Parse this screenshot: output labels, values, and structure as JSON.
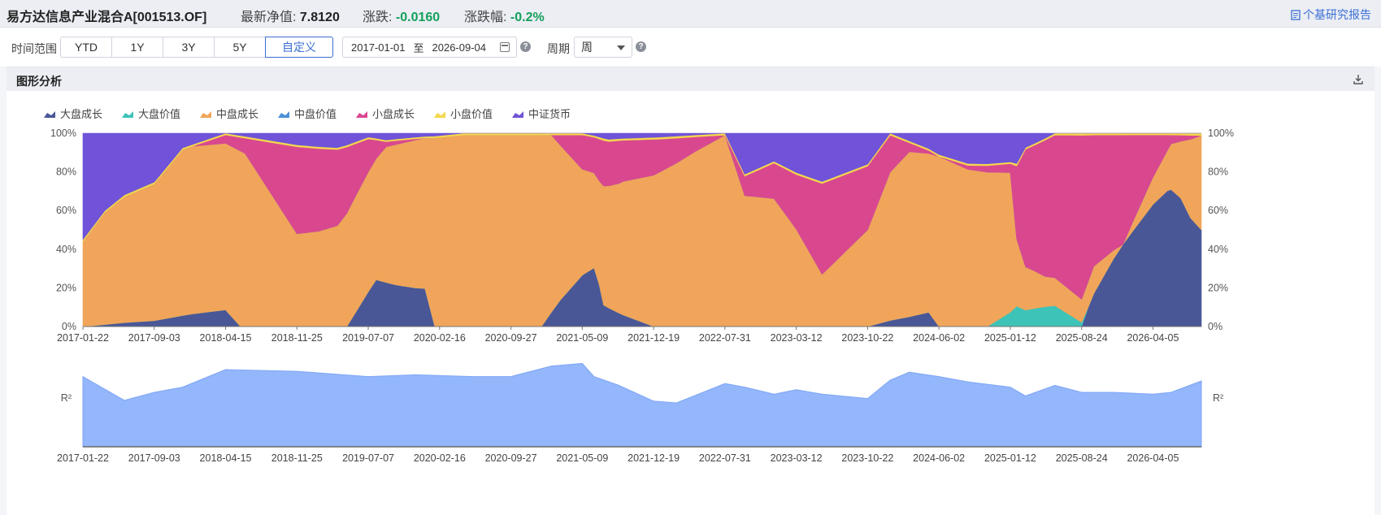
{
  "header": {
    "fund_name": "易方达信息产业混合A[001513.OF]",
    "nav_label": "最新净值:",
    "nav_value": "7.8120",
    "change_label": "涨跌:",
    "change_value": "-0.0160",
    "pct_label": "涨跌幅:",
    "pct_value": "-0.2%",
    "report_link": "个基研究报告"
  },
  "toolbar": {
    "range_label": "时间范围",
    "range_buttons": [
      "YTD",
      "1Y",
      "3Y",
      "5Y",
      "自定义"
    ],
    "active_range": "自定义",
    "start_date": "2017-01-01",
    "date_sep": "至",
    "end_date": "2026-09-04",
    "period_label": "周期",
    "period_value": "周"
  },
  "panel": {
    "title": "图形分析"
  },
  "colors": {
    "大盘成长": "#4a5797",
    "大盘价值": "#3ec3b8",
    "中盘成长": "#f0a55a",
    "中盘价值": "#4a8fd6",
    "小盘成长": "#d9488f",
    "小盘价值": "#f3d84c",
    "中证货币": "#7053d8",
    "r2_fill": "#94b6fb"
  },
  "chart_data": [
    {
      "type": "area",
      "stacked": true,
      "normalized": true,
      "legend_position": "top-left",
      "legend": [
        "大盘成长",
        "大盘价值",
        "中盘成长",
        "中盘价值",
        "小盘成长",
        "小盘价值",
        "中证货币"
      ],
      "x_ticks": [
        "2017-01-22",
        "2017-09-03",
        "2018-04-15",
        "2018-11-25",
        "2019-07-07",
        "2020-02-16",
        "2020-09-27",
        "2021-05-09",
        "2021-12-19",
        "2022-07-31",
        "2023-03-12",
        "2023-10-22",
        "2024-06-02",
        "2025-01-12",
        "2025-08-24",
        "2026-04-05"
      ],
      "y_ticks": [
        "0%",
        "20%",
        "40%",
        "60%",
        "80%",
        "100%"
      ],
      "ylim": [
        0,
        100
      ],
      "x_range": [
        "2017-01-22",
        "2026-09-04"
      ],
      "series": [
        {
          "name": "大盘成长",
          "points": [
            [
              "2017-01-22",
              0
            ],
            [
              "2017-06-01",
              2
            ],
            [
              "2017-09-03",
              3
            ],
            [
              "2018-01-01",
              7
            ],
            [
              "2018-04-15",
              10
            ],
            [
              "2018-06-01",
              0
            ],
            [
              "2019-05-01",
              0
            ],
            [
              "2019-07-07",
              18
            ],
            [
              "2019-08-01",
              27
            ],
            [
              "2019-10-01",
              25
            ],
            [
              "2020-01-01",
              24
            ],
            [
              "2020-02-01",
              0
            ],
            [
              "2021-01-01",
              0
            ],
            [
              "2021-03-01",
              15
            ],
            [
              "2021-05-09",
              30
            ],
            [
              "2021-06-15",
              34
            ],
            [
              "2021-07-15",
              10
            ],
            [
              "2021-12-19",
              0
            ],
            [
              "2023-10-22",
              0
            ],
            [
              "2024-05-01",
              8
            ],
            [
              "2024-06-02",
              0
            ],
            [
              "2025-08-24",
              0
            ],
            [
              "2025-10-01",
              18
            ],
            [
              "2025-12-01",
              38
            ],
            [
              "2026-02-01",
              55
            ],
            [
              "2026-04-05",
              72
            ],
            [
              "2026-05-20",
              80
            ],
            [
              "2026-07-01",
              70
            ],
            [
              "2026-08-01",
              50
            ],
            [
              "2026-09-04",
              43
            ]
          ]
        },
        {
          "name": "大盘价值",
          "points": [
            [
              "2017-01-22",
              0
            ],
            [
              "2024-11-01",
              0
            ],
            [
              "2025-01-12",
              8
            ],
            [
              "2025-04-01",
              10
            ],
            [
              "2025-06-01",
              11
            ],
            [
              "2025-08-24",
              2
            ],
            [
              "2025-09-15",
              0
            ],
            [
              "2026-09-04",
              0
            ]
          ]
        },
        {
          "name": "中盘成长",
          "points": [
            [
              "2017-01-22",
              44
            ],
            [
              "2017-04-01",
              62
            ],
            [
              "2017-09-03",
              70
            ],
            [
              "2017-12-01",
              90
            ],
            [
              "2018-04-15",
              100
            ],
            [
              "2018-06-15",
              92
            ],
            [
              "2018-09-01",
              70
            ],
            [
              "2018-11-25",
              48
            ],
            [
              "2019-02-01",
              50
            ],
            [
              "2019-05-15",
              60
            ],
            [
              "2019-07-07",
              62
            ],
            [
              "2019-09-01",
              80
            ],
            [
              "2019-12-01",
              93
            ],
            [
              "2020-02-16",
              98
            ],
            [
              "2020-09-27",
              100
            ],
            [
              "2021-02-01",
              98
            ],
            [
              "2021-05-09",
              62
            ],
            [
              "2021-07-01",
              52
            ],
            [
              "2021-09-15",
              70
            ],
            [
              "2021-12-19",
              76
            ],
            [
              "2022-03-01",
              80
            ],
            [
              "2022-05-01",
              90
            ],
            [
              "2022-07-31",
              98
            ],
            [
              "2022-10-01",
              67
            ],
            [
              "2023-01-01",
              73
            ],
            [
              "2023-03-12",
              50
            ],
            [
              "2023-06-01",
              27
            ],
            [
              "2023-10-22",
              50
            ],
            [
              "2024-01-01",
              72
            ],
            [
              "2024-03-01",
              92
            ],
            [
              "2024-06-02",
              88
            ],
            [
              "2024-09-01",
              83
            ],
            [
              "2025-01-12",
              78
            ],
            [
              "2025-02-01",
              28
            ],
            [
              "2025-05-01",
              16
            ],
            [
              "2025-08-24",
              11
            ],
            [
              "2025-10-01",
              15
            ],
            [
              "2026-01-01",
              0
            ],
            [
              "2026-09-04",
              42
            ]
          ]
        },
        {
          "name": "中盘价值",
          "points": [
            [
              "2017-01-22",
              0
            ],
            [
              "2026-09-04",
              0
            ]
          ]
        },
        {
          "name": "小盘成长",
          "points": [
            [
              "2017-01-22",
              0
            ],
            [
              "2018-01-01",
              0
            ],
            [
              "2018-06-15",
              8
            ],
            [
              "2018-11-25",
              45
            ],
            [
              "2019-04-01",
              42
            ],
            [
              "2019-07-07",
              17
            ],
            [
              "2019-09-01",
              3
            ],
            [
              "2020-01-01",
              0
            ],
            [
              "2021-02-01",
              0
            ],
            [
              "2021-05-09",
              20
            ],
            [
              "2021-09-01",
              22
            ],
            [
              "2021-12-19",
              18
            ],
            [
              "2022-07-31",
              0
            ],
            [
              "2022-10-01",
              10
            ],
            [
              "2023-03-12",
              28
            ],
            [
              "2023-06-01",
              47
            ],
            [
              "2023-10-22",
              33
            ],
            [
              "2024-03-01",
              5
            ],
            [
              "2024-06-02",
              0
            ],
            [
              "2025-01-12",
              5
            ],
            [
              "2025-03-01",
              66
            ],
            [
              "2025-06-01",
              75
            ],
            [
              "2025-08-24",
              78
            ],
            [
              "2025-10-01",
              72
            ],
            [
              "2026-01-01",
              62
            ],
            [
              "2026-04-05",
              25
            ],
            [
              "2026-06-01",
              5
            ],
            [
              "2026-09-04",
              0
            ]
          ]
        },
        {
          "name": "小盘价值",
          "points": [
            [
              "2017-01-22",
              1
            ],
            [
              "2026-09-04",
              1
            ]
          ]
        },
        {
          "name": "中证货币",
          "points": [
            [
              "2017-01-22",
              55
            ],
            [
              "2017-06-01",
              32
            ],
            [
              "2017-09-03",
              25
            ],
            [
              "2017-12-01",
              8
            ],
            [
              "2018-04-15",
              0
            ],
            [
              "2018-11-25",
              6
            ],
            [
              "2019-04-01",
              8
            ],
            [
              "2019-07-07",
              2
            ],
            [
              "2019-09-01",
              4
            ],
            [
              "2020-01-01",
              2
            ],
            [
              "2020-05-01",
              0
            ],
            [
              "2021-05-09",
              0
            ],
            [
              "2021-08-01",
              3
            ],
            [
              "2022-01-01",
              2
            ],
            [
              "2022-07-31",
              0
            ],
            [
              "2022-10-01",
              21
            ],
            [
              "2023-01-01",
              16
            ],
            [
              "2023-06-01",
              25
            ],
            [
              "2023-10-22",
              16
            ],
            [
              "2024-01-01",
              0
            ],
            [
              "2024-06-02",
              11
            ],
            [
              "2024-09-01",
              16
            ],
            [
              "2025-01-12",
              16
            ],
            [
              "2025-03-01",
              8
            ],
            [
              "2025-06-01",
              0
            ],
            [
              "2026-09-04",
              0
            ]
          ]
        }
      ]
    },
    {
      "type": "area",
      "ylabel": "R²",
      "x_ticks": [
        "2017-01-22",
        "2017-09-03",
        "2018-04-15",
        "2018-11-25",
        "2019-07-07",
        "2020-02-16",
        "2020-09-27",
        "2021-05-09",
        "2021-12-19",
        "2022-07-31",
        "2023-03-12",
        "2023-10-22",
        "2024-06-02",
        "2025-01-12",
        "2025-08-24",
        "2026-04-05"
      ],
      "ylim": [
        0,
        1
      ],
      "series": [
        {
          "name": "R²",
          "points": [
            [
              "2017-01-22",
              0.8
            ],
            [
              "2017-06-01",
              0.53
            ],
            [
              "2017-09-03",
              0.62
            ],
            [
              "2017-12-01",
              0.68
            ],
            [
              "2018-04-15",
              0.88
            ],
            [
              "2018-11-25",
              0.86
            ],
            [
              "2019-07-07",
              0.8
            ],
            [
              "2019-12-01",
              0.82
            ],
            [
              "2020-06-01",
              0.8
            ],
            [
              "2020-09-27",
              0.8
            ],
            [
              "2021-02-01",
              0.92
            ],
            [
              "2021-05-09",
              0.95
            ],
            [
              "2021-06-15",
              0.8
            ],
            [
              "2021-09-01",
              0.7
            ],
            [
              "2021-12-19",
              0.52
            ],
            [
              "2022-03-01",
              0.5
            ],
            [
              "2022-07-31",
              0.72
            ],
            [
              "2022-10-01",
              0.68
            ],
            [
              "2023-01-01",
              0.6
            ],
            [
              "2023-03-12",
              0.65
            ],
            [
              "2023-06-01",
              0.6
            ],
            [
              "2023-10-22",
              0.55
            ],
            [
              "2024-01-01",
              0.76
            ],
            [
              "2024-03-01",
              0.85
            ],
            [
              "2024-06-02",
              0.8
            ],
            [
              "2024-09-01",
              0.74
            ],
            [
              "2025-01-12",
              0.68
            ],
            [
              "2025-03-01",
              0.58
            ],
            [
              "2025-06-01",
              0.7
            ],
            [
              "2025-08-24",
              0.62
            ],
            [
              "2025-12-01",
              0.62
            ],
            [
              "2026-04-05",
              0.6
            ],
            [
              "2026-06-01",
              0.62
            ],
            [
              "2026-09-04",
              0.75
            ]
          ]
        }
      ]
    }
  ]
}
